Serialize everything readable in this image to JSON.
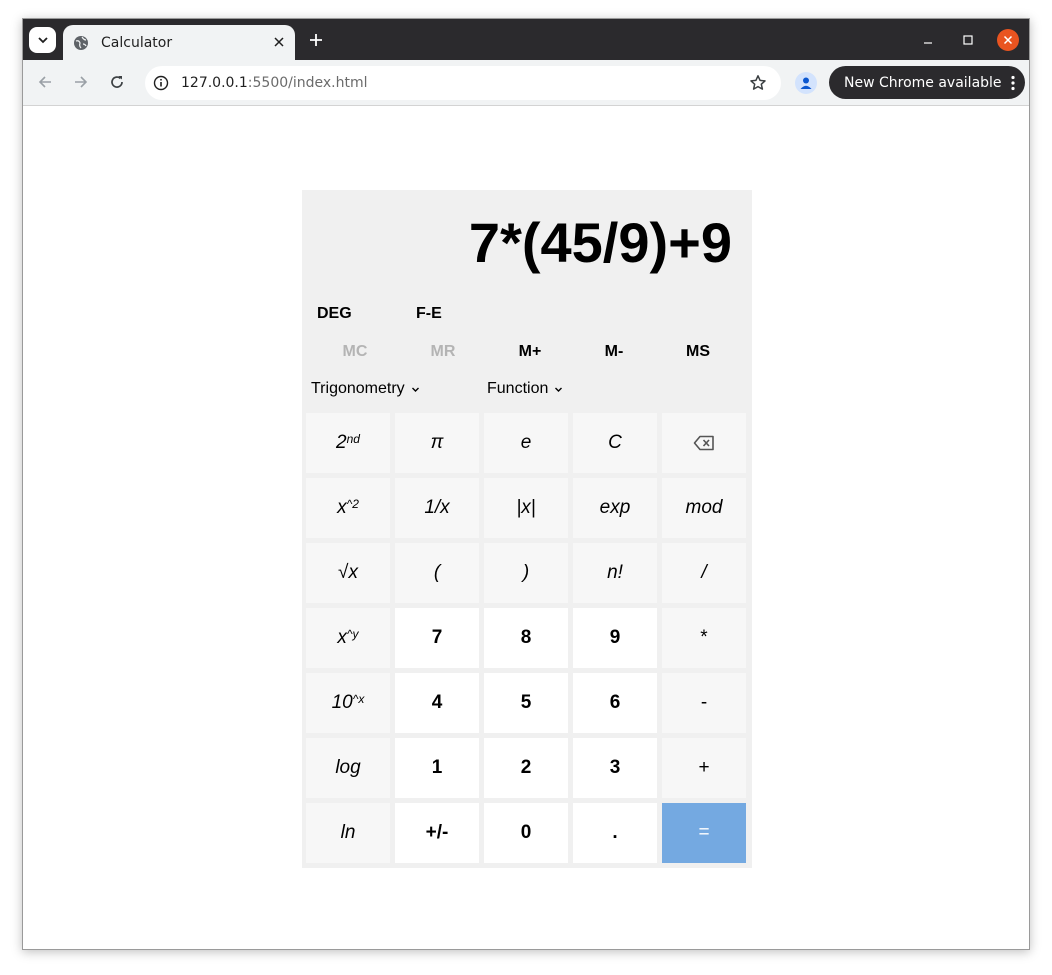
{
  "browser": {
    "tab_title": "Calculator",
    "url_host": "127.0.0.1",
    "url_rest": ":5500/index.html",
    "update_label": "New Chrome available"
  },
  "calculator": {
    "display": "7*(45/9)+9",
    "angle_mode": "DEG",
    "fe_label": "F-E",
    "memory": {
      "mc": "MC",
      "mr": "MR",
      "mplus": "M+",
      "mminus": "M-",
      "ms": "MS"
    },
    "trig_dropdown": "Trigonometry",
    "func_dropdown": "Function",
    "keys": {
      "second_base": "2",
      "second_sup": "nd",
      "pi": "π",
      "e": "e",
      "clear": "C",
      "square_base": "x",
      "square_sup": "^2",
      "reciprocal": "1/x",
      "abs": "|x|",
      "exp": "exp",
      "mod": "mod",
      "sqrt": "√x",
      "lparen": "(",
      "rparen": ")",
      "factorial": "n!",
      "divide": "/",
      "pow_base": "x",
      "pow_sup": "^y",
      "seven": "7",
      "eight": "8",
      "nine": "9",
      "multiply": "*",
      "tenpow_base": "10",
      "tenpow_sup": "^x",
      "four": "4",
      "five": "5",
      "six": "6",
      "minus": "-",
      "log": "log",
      "one": "1",
      "two": "2",
      "three": "3",
      "plus": "+",
      "ln": "ln",
      "negate": "+/-",
      "zero": "0",
      "dot": ".",
      "equals": "="
    }
  },
  "colors": {
    "equals_bg": "#74a9e1",
    "calc_bg": "#f0f0f0",
    "close_btn": "#e95420"
  }
}
